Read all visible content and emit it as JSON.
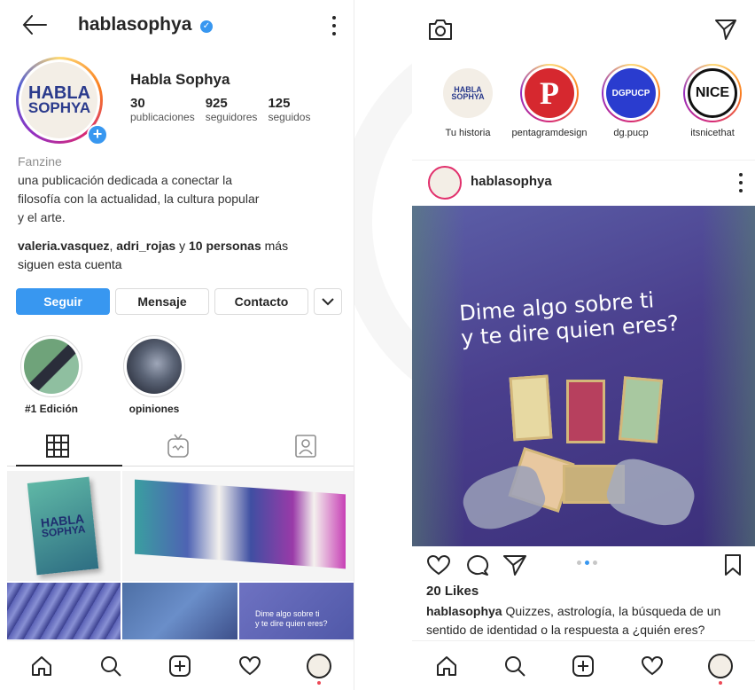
{
  "left": {
    "username": "hablasophya",
    "verified_mark": "✓",
    "avatar_logo_line1": "HABLA",
    "avatar_logo_line2": "SOPHYA",
    "profile_name": "Habla Sophya",
    "stats": [
      {
        "value": "30",
        "label": "publicaciones"
      },
      {
        "value": "925",
        "label": "seguidores"
      },
      {
        "value": "125",
        "label": "seguidos"
      }
    ],
    "category": "Fanzine",
    "bio_line1": "una publicación dedicada a conectar la",
    "bio_line2": "filosofía con la actualidad, la cultura popular",
    "bio_line3": "y el arte.",
    "followed_user1": "valeria.vasquez",
    "followed_sep": ", ",
    "followed_user2": "adri_rojas",
    "followed_and": " y ",
    "followed_count": "10 personas",
    "followed_tail": " más",
    "followed_line2": "siguen esta cuenta",
    "buttons": {
      "follow": "Seguir",
      "message": "Mensaje",
      "contact": "Contacto"
    },
    "highlights": [
      {
        "label": "#1 Edición"
      },
      {
        "label": "opiniones"
      }
    ],
    "grid_tile_text_line1": "Dime algo sobre ti",
    "grid_tile_text_line2": "y te dire quien eres?",
    "cover_line1": "HABLA",
    "cover_line2": "SOPHYA"
  },
  "right": {
    "stories": [
      {
        "label": "Tu historia",
        "pic_text": "HABLA SOPHYA"
      },
      {
        "label": "pentagramdesign",
        "pic_text": "P"
      },
      {
        "label": "dg.pucp",
        "pic_text": "DGPUCP"
      },
      {
        "label": "itsnicethat",
        "pic_text": "NICE"
      }
    ],
    "post_user": "hablasophya",
    "post_text_line1": "Dime algo sobre ti",
    "post_text_line2": "y te dire quien eres?",
    "likes": "20 Likes",
    "caption_user": "hablasophya",
    "caption_text": " Quizzes, astrología, la búsqueda de un sentido de identidad o la respuesta a ¿quién eres?"
  },
  "colors": {
    "accent": "#3897f0",
    "notification": "#ed4956",
    "post_bg": "#4a3f8d"
  }
}
